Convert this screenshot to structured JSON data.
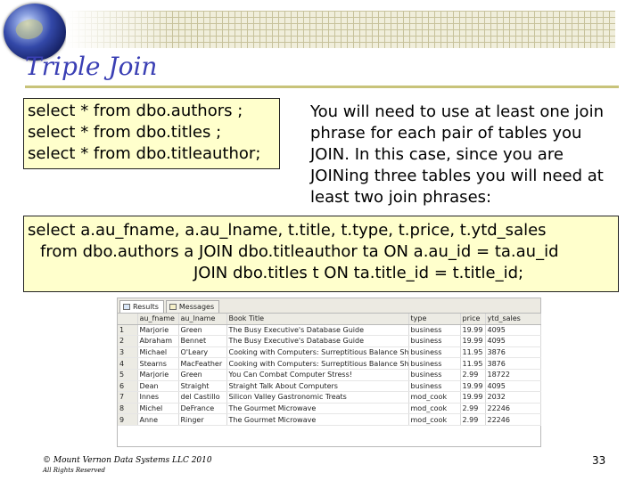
{
  "slide": {
    "title": "Triple Join",
    "page_number": "33"
  },
  "query_box": {
    "lines": [
      "select * from dbo.authors ;",
      "select * from dbo.titles ;",
      "select * from dbo.titleauthor;"
    ]
  },
  "note": {
    "text": "You will need to use at least one join phrase for each pair of tables you JOIN. In this case, since you are JOINing three tables you will need at least two join phrases:"
  },
  "join_box": {
    "lines": [
      "select a.au_fname, a.au_lname, t.title, t.type, t.price, t.ytd_sales",
      "from dbo.authors a JOIN dbo.titleauthor ta ON a.au_id = ta.au_id",
      "JOIN dbo.titles t ON ta.title_id = t.title_id;"
    ]
  },
  "results_grid": {
    "tabs": [
      {
        "label": "Results",
        "icon": "grid-icon"
      },
      {
        "label": "Messages",
        "icon": "messages-icon"
      }
    ],
    "columns": [
      "",
      "au_fname",
      "au_lname",
      "Book Title",
      "type",
      "price",
      "ytd_sales"
    ],
    "rows": [
      [
        "1",
        "Marjorie",
        "Green",
        "The Busy Executive's Database Guide",
        "business",
        "19.99",
        "4095"
      ],
      [
        "2",
        "Abraham",
        "Bennet",
        "The Busy Executive's Database Guide",
        "business",
        "19.99",
        "4095"
      ],
      [
        "3",
        "Michael",
        "O'Leary",
        "Cooking with Computers: Surreptitious Balance Sheets",
        "business",
        "11.95",
        "3876"
      ],
      [
        "4",
        "Stearns",
        "MacFeather",
        "Cooking with Computers: Surreptitious Balance Sheets",
        "business",
        "11.95",
        "3876"
      ],
      [
        "5",
        "Marjorie",
        "Green",
        "You Can Combat Computer Stress!",
        "business",
        "2.99",
        "18722"
      ],
      [
        "6",
        "Dean",
        "Straight",
        "Straight Talk About Computers",
        "business",
        "19.99",
        "4095"
      ],
      [
        "7",
        "Innes",
        "del Castillo",
        "Silicon Valley Gastronomic Treats",
        "mod_cook",
        "19.99",
        "2032"
      ],
      [
        "8",
        "Michel",
        "DeFrance",
        "The Gourmet Microwave",
        "mod_cook",
        "2.99",
        "22246"
      ],
      [
        "9",
        "Anne",
        "Ringer",
        "The Gourmet Microwave",
        "mod_cook",
        "2.99",
        "22246"
      ]
    ]
  },
  "footer": {
    "copyright": "© Mount Vernon Data Systems LLC 2010",
    "rights": "All Rights Reserved"
  }
}
